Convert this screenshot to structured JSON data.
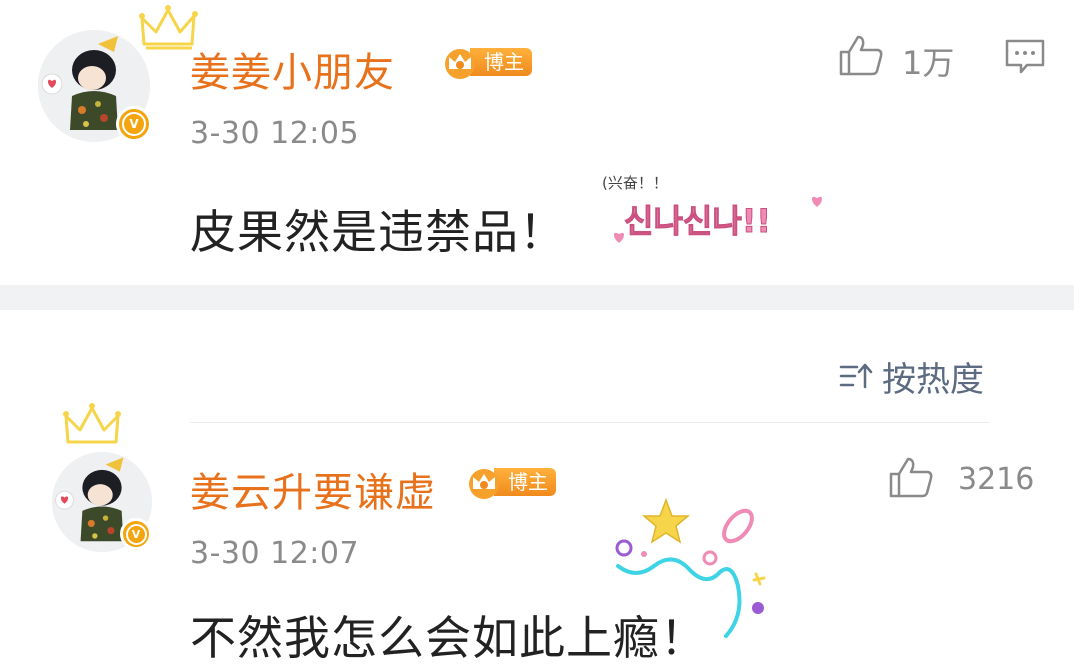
{
  "post": {
    "username": "姜姜小朋友",
    "badge": "博主",
    "timestamp": "3-30  12:05",
    "content": "皮果然是违禁品！",
    "like_count": "1万",
    "sticker_caption": "(兴奋！！",
    "sticker_text": "신나신나!!"
  },
  "sort": {
    "label": "按热度"
  },
  "comment": {
    "username": "姜云升要谦虚",
    "badge": "博主",
    "timestamp": "3-30  12:07",
    "content": "不然我怎么会如此上瘾！",
    "like_count": "3216"
  },
  "colors": {
    "username": "#e8721c",
    "badge_gradient_top": "#ffb13b",
    "badge_gradient_bottom": "#f08a1d",
    "verified_badge": "#f4a40c",
    "meta_gray": "#8a8a8a",
    "sort_blue_gray": "#5c6b82",
    "separator": "#f1f2f4",
    "crown_yellow": "#f6d54a",
    "sticker_pink": "#f08bb5"
  },
  "icons": {
    "like": "thumbs-up-icon",
    "comment": "comment-bubble-icon",
    "sort": "sort-icon",
    "crown": "crown-icon",
    "verified": "verified-v-icon"
  }
}
